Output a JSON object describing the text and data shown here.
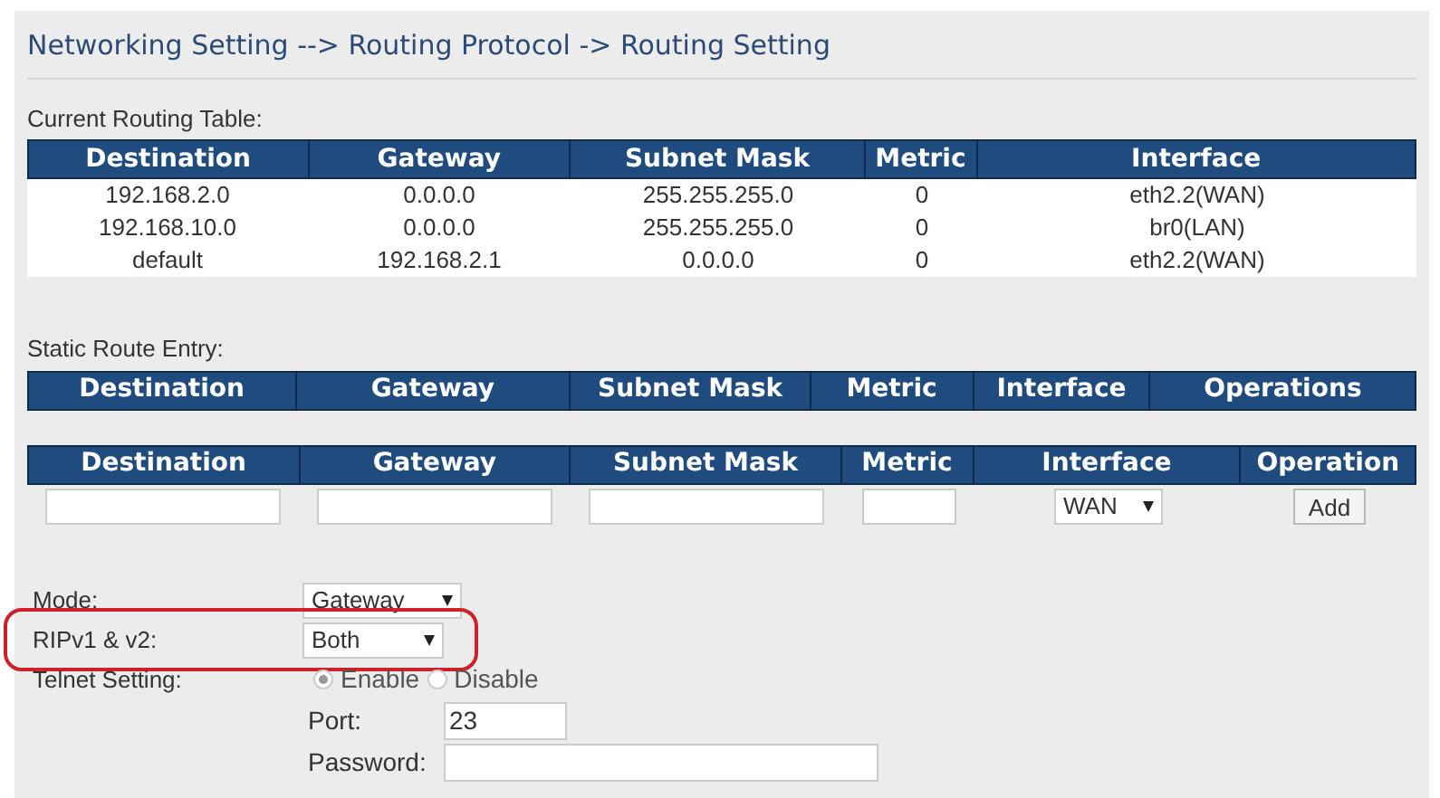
{
  "breadcrumb": "Networking Setting --> Routing Protocol -> Routing Setting",
  "current_table": {
    "label": "Current Routing Table:",
    "columns": [
      "Destination",
      "Gateway",
      "Subnet Mask",
      "Metric",
      "Interface"
    ],
    "rows": [
      [
        "192.168.2.0",
        "0.0.0.0",
        "255.255.255.0",
        "0",
        "eth2.2(WAN)"
      ],
      [
        "192.168.10.0",
        "0.0.0.0",
        "255.255.255.0",
        "0",
        "br0(LAN)"
      ],
      [
        "default",
        "192.168.2.1",
        "0.0.0.0",
        "0",
        "eth2.2(WAN)"
      ]
    ]
  },
  "static_table": {
    "label": "Static Route Entry:",
    "columns": [
      "Destination",
      "Gateway",
      "Subnet Mask",
      "Metric",
      "Interface",
      "Operations"
    ]
  },
  "entry_table": {
    "columns": [
      "Destination",
      "Gateway",
      "Subnet Mask",
      "Metric",
      "Interface",
      "Operation"
    ],
    "interface": "WAN",
    "button": "Add"
  },
  "settings": [
    {
      "kind": "select",
      "label": "Mode:",
      "value": "Gateway",
      "highlighted": false
    },
    {
      "kind": "select",
      "label": "RIPv1 & v2:",
      "value": "Both",
      "highlighted": true
    },
    {
      "kind": "radio",
      "label": "Telnet Setting:",
      "highlighted": false,
      "options": [
        {
          "label": "Enable",
          "selected": true
        },
        {
          "label": "Disable",
          "selected": false
        }
      ],
      "fields": [
        {
          "label": "Port:",
          "value": "23"
        },
        {
          "label": "Password:"
        }
      ]
    }
  ]
}
